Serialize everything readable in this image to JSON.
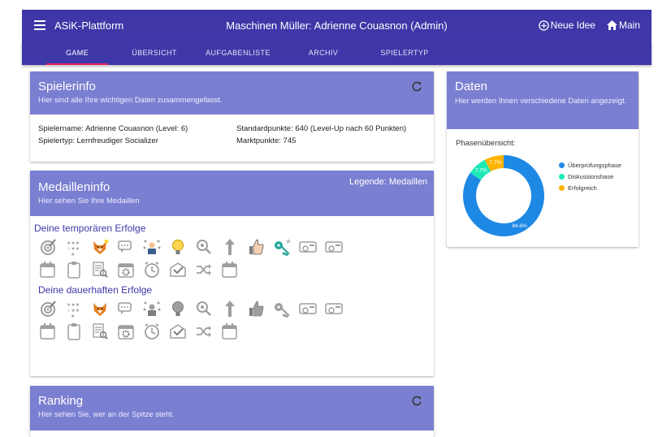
{
  "header": {
    "app_title": "ASiK-Plattform",
    "center_title": "Maschinen Müller: Adrienne Couasnon (Admin)",
    "new_idea": "Neue Idee",
    "main": "Main"
  },
  "tabs": [
    {
      "label": "GAME",
      "active": true
    },
    {
      "label": "ÜBERSICHT"
    },
    {
      "label": "AUFGABENLISTE"
    },
    {
      "label": "ARCHIV"
    },
    {
      "label": "SPIELERTYP"
    }
  ],
  "spielerinfo": {
    "title": "Spielerinfo",
    "subtitle": "Hier sind alle Ihre wichtigen Daten zusammengefasst.",
    "name": "Spielername: Adrienne Couasnon (Level: 6)",
    "type": "Spielertyp: Lernfreudiger Socializer",
    "standard": "Standardpunkte: 640 (Level-Up nach 60 Punkten)",
    "market": "Marktpunkte: 745"
  },
  "medailleninfo": {
    "title": "Medailleninfo",
    "subtitle": "Hier sehen Sie Ihre Medaillen",
    "legend_link": "Legende: Medaillen",
    "temp_title": "Deine temporären Erfolge",
    "perm_title": "Deine dauerhaften Erfolge",
    "row1_icons": [
      "target-icon",
      "stars-icon",
      "fox-icon",
      "chat-icon",
      "network-icon",
      "bulb-icon",
      "magnifier-icon",
      "arrow-up-icon",
      "thumbs-up-icon",
      "key-icon",
      "ticket-icon",
      "ticket-icon"
    ],
    "row2_icons": [
      "calendar-icon",
      "clipboard-icon",
      "document-search-icon",
      "gear-calendar-icon",
      "clock-icon",
      "envelope-icon",
      "shuffle-icon",
      "calendar-icon"
    ]
  },
  "ranking": {
    "title": "Ranking",
    "subtitle": "Hier sehen Sie, wer an der Spitze steht."
  },
  "daten": {
    "title": "Daten",
    "subtitle": "Hier werden Ihnen verschiedene Daten angezeigt.",
    "phase_label": "Phasenübersicht:"
  },
  "chart_data": {
    "type": "pie",
    "title": "",
    "series": [
      {
        "name": "Überprüfungsphase",
        "value": 84.6,
        "color": "#1e88e5"
      },
      {
        "name": "Diskussionshase",
        "value": 7.7,
        "color": "#1de9b6"
      },
      {
        "name": "Erfolgreich",
        "value": 7.7,
        "color": "#ffb300"
      }
    ],
    "labels": [
      "84.6%",
      "7.7%",
      "7.7%"
    ],
    "legend_position": "right"
  }
}
